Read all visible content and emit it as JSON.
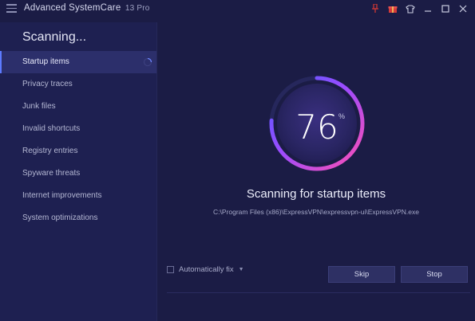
{
  "window": {
    "title": "Advanced SystemCare",
    "version": "13 Pro",
    "icons": [
      "pin-icon",
      "gift-icon",
      "skin-icon",
      "minimize-icon",
      "maximize-icon",
      "close-icon"
    ]
  },
  "sidebar": {
    "heading": "Scanning...",
    "items": [
      {
        "label": "Startup items",
        "active": true
      },
      {
        "label": "Privacy traces"
      },
      {
        "label": "Junk files"
      },
      {
        "label": "Invalid shortcuts"
      },
      {
        "label": "Registry entries"
      },
      {
        "label": "Spyware threats"
      },
      {
        "label": "Internet improvements"
      },
      {
        "label": "System optimizations"
      }
    ]
  },
  "progress": {
    "value": "76",
    "percent_sign": "%",
    "fraction": 0.76
  },
  "status": {
    "title": "Scanning for startup items",
    "path": "C:\\Program Files (x86)\\ExpressVPN\\expressvpn-ui\\ExpressVPN.exe"
  },
  "controls": {
    "autofix_label": "Automatically fix",
    "autofix_checked": false,
    "skip_label": "Skip",
    "stop_label": "Stop"
  },
  "colors": {
    "background": "#1b1c45",
    "sidebar": "#1e2051",
    "active_item": "#2c2f6b",
    "ring_start": "#ff4fb3",
    "ring_end": "#4f5bff"
  }
}
